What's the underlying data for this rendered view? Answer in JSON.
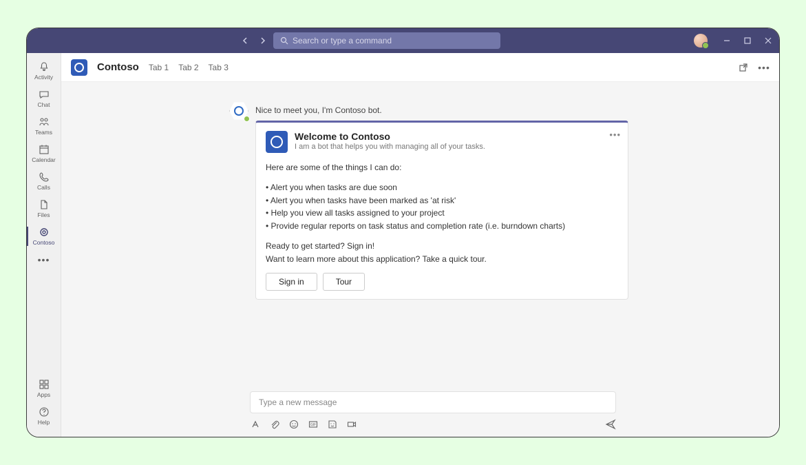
{
  "titlebar": {
    "search_placeholder": "Search or type a command"
  },
  "rail": {
    "items": [
      {
        "label": "Activity"
      },
      {
        "label": "Chat"
      },
      {
        "label": "Teams"
      },
      {
        "label": "Calendar"
      },
      {
        "label": "Calls"
      },
      {
        "label": "Files"
      },
      {
        "label": "Contoso"
      }
    ],
    "bottom": [
      {
        "label": "Apps"
      },
      {
        "label": "Help"
      }
    ]
  },
  "header": {
    "app_name": "Contoso",
    "tabs": [
      "Tab 1",
      "Tab 2",
      "Tab 3"
    ]
  },
  "chat": {
    "greeting": "Nice to meet you, I'm Contoso bot.",
    "card": {
      "title": "Welcome to Contoso",
      "subtitle": "I am a bot that helps you with managing all of your tasks.",
      "intro": "Here are some of the things I can do:",
      "bullets": [
        "• Alert you when tasks are due soon",
        "• Alert you when tasks have been marked as 'at risk'",
        "• Help you view all tasks assigned to your project",
        "• Provide regular reports on task status and completion rate  (i.e. burndown charts)"
      ],
      "ready": "Ready to get started? Sign in!",
      "learn": "Want to learn more about this application? Take a quick tour.",
      "actions": {
        "signin": "Sign in",
        "tour": "Tour"
      }
    }
  },
  "compose": {
    "placeholder": "Type a new message"
  }
}
